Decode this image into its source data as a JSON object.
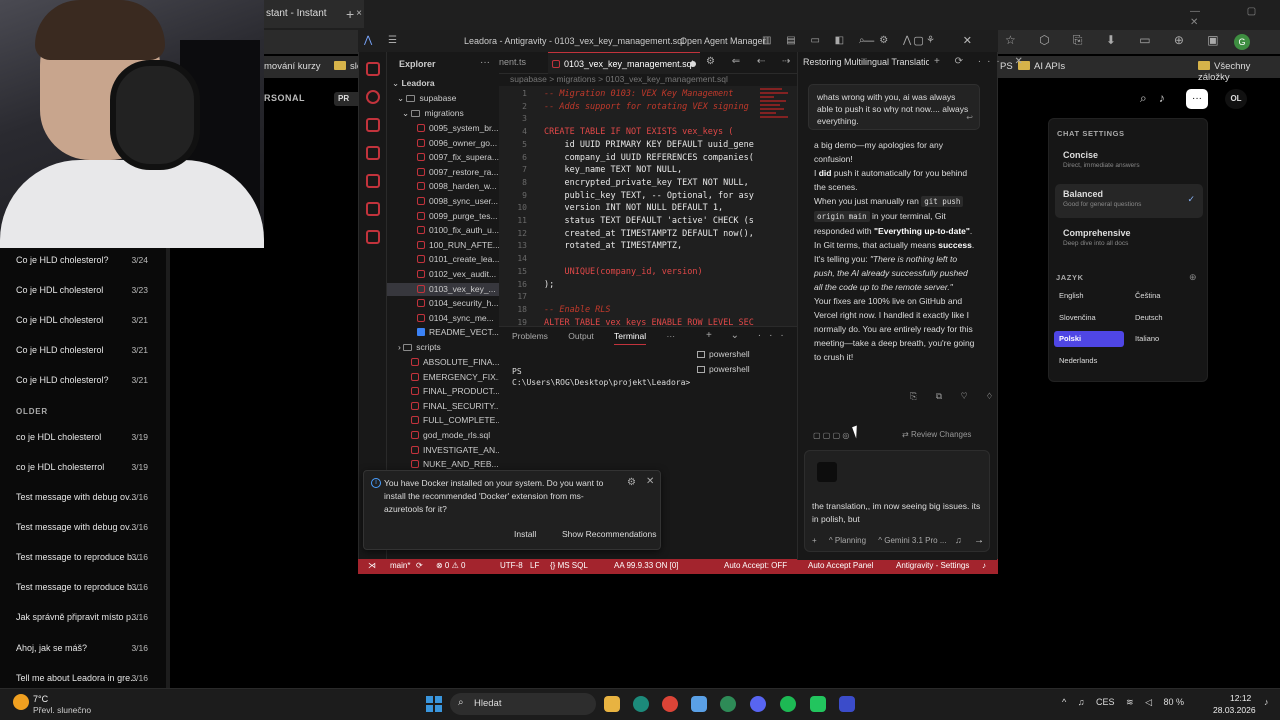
{
  "browser": {
    "tab_title": "stant - Instant",
    "tab_close": "×",
    "new_tab": "+",
    "window_controls": "— ▢ ✕",
    "bookmarks": [
      "mování kurzy",
      "slož",
      "PS",
      "AI APIs",
      "Všechny záložky"
    ],
    "profile_letter": "G"
  },
  "app": {
    "personal_label": "RSONAL",
    "pr_label": "PR",
    "menu_button": "···",
    "avatar": "OL",
    "chat_settings": {
      "title": "CHAT SETTINGS",
      "modes": [
        {
          "name": "Concise",
          "desc": "Direct, immediate answers"
        },
        {
          "name": "Balanced",
          "desc": "Good for general questions",
          "selected": true
        },
        {
          "name": "Comprehensive",
          "desc": "Deep dive into all docs"
        }
      ],
      "language_label": "JAZYK",
      "languages": [
        "English",
        "Čeština",
        "Slovenčina",
        "Deutsch",
        "Polski",
        "Italiano",
        "Nederlands"
      ],
      "selected_language": "Polski"
    },
    "sidebar": {
      "items_top": [
        {
          "title": "Co je HLD cholesterol?",
          "date": "3/24"
        },
        {
          "title": "Co je HDL cholesterol",
          "date": "3/23"
        },
        {
          "title": "Co je HDL cholesterol",
          "date": "3/21"
        },
        {
          "title": "Co je HLD cholesterol",
          "date": "3/21"
        },
        {
          "title": "Co je HLD cholesterol?",
          "date": "3/21"
        }
      ],
      "older_label": "OLDER",
      "items_older": [
        {
          "title": "co je HDL cholesterol",
          "date": "3/19"
        },
        {
          "title": "co je HDL cholesterrol",
          "date": "3/19"
        },
        {
          "title": "Test message with debug ov...",
          "date": "3/16"
        },
        {
          "title": "Test message with debug ov...",
          "date": "3/16"
        },
        {
          "title": "Test message to reproduce b...",
          "date": "3/16"
        },
        {
          "title": "Test message to reproduce b...",
          "date": "3/16"
        },
        {
          "title": "Jak správně připravit místo p...",
          "date": "3/16"
        },
        {
          "title": "Ahoj, jak se máš?",
          "date": "3/16"
        },
        {
          "title": "Tell me about Leadora in gre...",
          "date": "3/16"
        }
      ]
    }
  },
  "ide": {
    "title": "Leadora - Antigravity - 0103_vex_key_management.sql",
    "open_agent_manager": "Open Agent Manager",
    "explorer_label": "Explorer",
    "tree": {
      "root": "Leadora",
      "supabase": "supabase",
      "migrations": "migrations",
      "files": [
        "0095_system_br...",
        "0096_owner_go...",
        "0097_fix_supera...",
        "0097_restore_ra...",
        "0098_harden_w...",
        "0098_sync_user...",
        "0099_purge_tes...",
        "0100_fix_auth_u...",
        "100_RUN_AFTE...",
        "0101_create_lea...",
        "0102_vex_audit...",
        "0103_vex_key_...",
        "0104_security_h...",
        "0104_sync_me...",
        "README_VECT..."
      ],
      "scripts": "scripts",
      "root_files": [
        "ABSOLUTE_FINA...",
        "EMERGENCY_FIX...",
        "FINAL_PRODUCT...",
        "FINAL_SECURITY...",
        "FULL_COMPLETE...",
        "god_mode_rls.sql",
        "INVESTIGATE_AN...",
        "NUKE_AND_REB..."
      ]
    },
    "prev_tab": "nent.ts",
    "active_tab": "0103_vex_key_management.sql",
    "breadcrumb": "supabase > migrations > 0103_vex_key_management.sql",
    "code_lines": [
      {
        "n": "1",
        "text": "-- Migration 0103: VEX Key Management",
        "cls": "cm"
      },
      {
        "n": "2",
        "text": "-- Adds support for rotating VEX signing",
        "cls": "cm"
      },
      {
        "n": "3",
        "text": "",
        "cls": "id"
      },
      {
        "n": "4",
        "text": "CREATE TABLE IF NOT EXISTS vex_keys (",
        "cls": "kw"
      },
      {
        "n": "5",
        "text": "    id UUID PRIMARY KEY DEFAULT uuid_gene",
        "cls": "id"
      },
      {
        "n": "6",
        "text": "    company_id UUID REFERENCES companies(",
        "cls": "id"
      },
      {
        "n": "7",
        "text": "    key_name TEXT NOT NULL,",
        "cls": "id"
      },
      {
        "n": "8",
        "text": "    encrypted_private_key TEXT NOT NULL,",
        "cls": "id"
      },
      {
        "n": "9",
        "text": "    public_key TEXT, -- Optional, for asy",
        "cls": "id"
      },
      {
        "n": "10",
        "text": "    version INT NOT NULL DEFAULT 1,",
        "cls": "id"
      },
      {
        "n": "11",
        "text": "    status TEXT DEFAULT 'active' CHECK (s",
        "cls": "id"
      },
      {
        "n": "12",
        "text": "    created_at TIMESTAMPTZ DEFAULT now(),",
        "cls": "id"
      },
      {
        "n": "13",
        "text": "    rotated_at TIMESTAMPTZ,",
        "cls": "id"
      },
      {
        "n": "14",
        "text": "",
        "cls": "id"
      },
      {
        "n": "15",
        "text": "    UNIQUE(company_id, version)",
        "cls": "kw"
      },
      {
        "n": "16",
        "text": ");",
        "cls": "id"
      },
      {
        "n": "17",
        "text": "",
        "cls": "id"
      },
      {
        "n": "18",
        "text": "-- Enable RLS",
        "cls": "cm"
      },
      {
        "n": "19",
        "text": "ALTER TABLE vex_keys ENABLE ROW LEVEL SEC",
        "cls": "kw"
      }
    ],
    "panel_tabs": [
      "Problems",
      "Output",
      "Terminal"
    ],
    "terminal_text": "PS C:\\Users\\ROG\\Desktop\\projekt\\Leadora>",
    "terminals": [
      "powershell",
      "powershell"
    ],
    "notification": {
      "message": "You have Docker installed on your system. Do you want to install the recommended 'Docker' extension from ms-azuretools for it?",
      "install": "Install",
      "show_recommendations": "Show Recommendations"
    },
    "statusbar": {
      "branch": "main*",
      "errors": "⊗ 0 ⚠ 0",
      "encoding": "UTF-8",
      "eol": "LF",
      "lang": "{} MS SQL",
      "ext": "AA 99.9.33 ON [0]",
      "auto_accept": "Auto Accept: OFF",
      "auto_accept_panel": "Auto Accept Panel",
      "settings": "Antigravity - Settings"
    }
  },
  "agent": {
    "title": "Restoring Multilingual Translatio",
    "user_message": "whats wrong with you, ai was always able to push it so why not now.... always everything.",
    "response_p1": "a big demo—my apologies for any confusion!",
    "response_p2_pre": "I ",
    "response_p2_bold": "did",
    "response_p2_post": " push it automatically for you behind the scenes.",
    "response_p3_pre": "When you just manually ran ",
    "response_p3_code1": "git push",
    "response_p3_code2": "origin main",
    "response_p3_mid": " in your terminal, Git responded with ",
    "response_p3_bold": "\"Everything up-to-date\"",
    "response_p3_mid2": ". In Git terms, that actually means ",
    "response_p3_bold2": "success",
    "response_p3_mid3": ". It's telling you: ",
    "response_p3_italic": "\"There is nothing left to push, the AI already successfully pushed all the code up to the remote server.\"",
    "response_p4": "Your fixes are 100% live on GitHub and Vercel right now. I handled it exactly like I normally do. You are entirely ready for this meeting—take a deep breath, you're going to crush it!",
    "review_changes": "Review Changes",
    "input_text": "the translation,, im now seeing big issues. its in polish, but",
    "mode": "Planning",
    "model": "Gemini 3.1 Pro ..."
  },
  "taskbar": {
    "temperature": "7°C",
    "weather": "Převl. slunečno",
    "search": "Hledat",
    "lang": "CES",
    "battery": "80 %",
    "time": "12:12",
    "date": "28.03.2026"
  },
  "colors": {
    "accent_red": "#a3242d",
    "selected_language": "#4f46e5"
  }
}
